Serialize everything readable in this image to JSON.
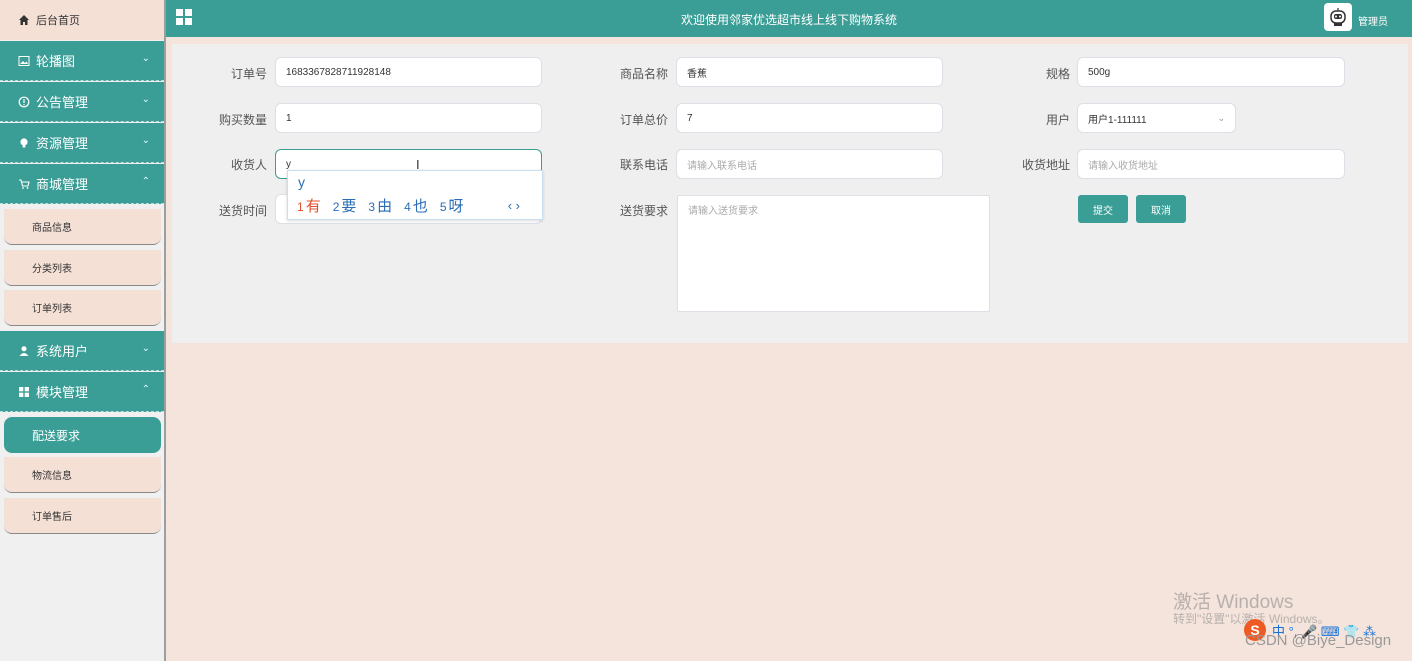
{
  "sidebar": {
    "home": "后台首页",
    "groups": [
      {
        "label": "轮播图",
        "chevron": "⌄"
      },
      {
        "label": "公告管理",
        "chevron": "⌄"
      },
      {
        "label": "资源管理",
        "chevron": "⌄"
      },
      {
        "label": "商城管理",
        "chevron": "⌃"
      },
      {
        "label": "系统用户",
        "chevron": "⌄"
      },
      {
        "label": "模块管理",
        "chevron": "⌃"
      }
    ],
    "shop_items": [
      "商品信息",
      "分类列表",
      "订单列表"
    ],
    "module_items": [
      "配送要求",
      "物流信息",
      "订单售后"
    ]
  },
  "header": {
    "title": "欢迎使用邻家优选超市线上线下购物系统",
    "user": "管理员"
  },
  "form": {
    "order_no": {
      "label": "订单号",
      "value": "1683367828711928148"
    },
    "product_name": {
      "label": "商品名称",
      "value": "香蕉"
    },
    "spec": {
      "label": "规格",
      "value": "500g"
    },
    "quantity": {
      "label": "购买数量",
      "value": "1"
    },
    "total": {
      "label": "订单总价",
      "value": "7"
    },
    "user": {
      "label": "用户",
      "value": "用户1-111111"
    },
    "receiver": {
      "label": "收货人",
      "value": "y"
    },
    "phone": {
      "label": "联系电话",
      "placeholder": "请输入联系电话"
    },
    "address": {
      "label": "收货地址",
      "placeholder": "请输入收货地址"
    },
    "delivery_time": {
      "label": "送货时间"
    },
    "delivery_req": {
      "label": "送货要求",
      "placeholder": "请输入送货要求"
    },
    "submit": "提交",
    "cancel": "取消"
  },
  "ime": {
    "composition": "y",
    "candidates": [
      {
        "n": "1",
        "text": "有"
      },
      {
        "n": "2",
        "text": "要"
      },
      {
        "n": "3",
        "text": "由"
      },
      {
        "n": "4",
        "text": "也"
      },
      {
        "n": "5",
        "text": "呀"
      }
    ],
    "nav": "‹ ›"
  },
  "overlay": {
    "activate_title": "激活 Windows",
    "activate_sub": "转到\"设置\"以激活 Windows。",
    "csdn": "CSDN @Biye_Design",
    "tray_text": "中 °, 🎤 ⌨ 👕 ⁂"
  },
  "colors": {
    "primary": "#3b9e96",
    "page_bg": "#f5e4dc",
    "panel_bg": "#efefef"
  }
}
